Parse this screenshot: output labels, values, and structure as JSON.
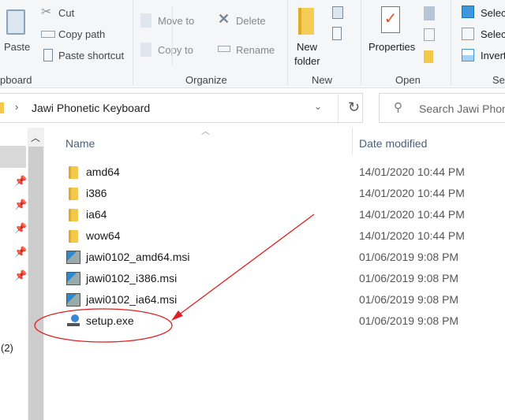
{
  "ribbon": {
    "clipboard": {
      "paste": "Paste",
      "cut": "Cut",
      "copy_path": "Copy path",
      "paste_shortcut": "Paste shortcut",
      "group": "pboard"
    },
    "organize": {
      "move_to": "Move to",
      "copy_to": "Copy to",
      "delete": "Delete",
      "rename": "Rename",
      "group": "Organize"
    },
    "new": {
      "new_folder_1": "New",
      "new_folder_2": "folder",
      "group": "New"
    },
    "open": {
      "properties": "Properties",
      "group": "Open"
    },
    "select": {
      "select_all": "Selec",
      "select_none": "Selec",
      "invert": "Invert",
      "group": "Sel"
    }
  },
  "address": {
    "path": "Jawi Phonetic Keyboard",
    "search_placeholder": "Search Jawi Phon"
  },
  "nav": {
    "count_label": "(2)"
  },
  "columns": {
    "name": "Name",
    "date": "Date modified"
  },
  "files": [
    {
      "name": "amd64",
      "date": "14/01/2020 10:44 PM",
      "type": "folder"
    },
    {
      "name": "i386",
      "date": "14/01/2020 10:44 PM",
      "type": "folder"
    },
    {
      "name": "ia64",
      "date": "14/01/2020 10:44 PM",
      "type": "folder"
    },
    {
      "name": "wow64",
      "date": "14/01/2020 10:44 PM",
      "type": "folder"
    },
    {
      "name": "jawi0102_amd64.msi",
      "date": "01/06/2019 9:08 PM",
      "type": "msi"
    },
    {
      "name": "jawi0102_i386.msi",
      "date": "01/06/2019 9:08 PM",
      "type": "msi"
    },
    {
      "name": "jawi0102_ia64.msi",
      "date": "01/06/2019 9:08 PM",
      "type": "msi"
    },
    {
      "name": "setup.exe",
      "date": "01/06/2019 9:08 PM",
      "type": "exe"
    }
  ],
  "annotation": {
    "color": "#e02020"
  }
}
